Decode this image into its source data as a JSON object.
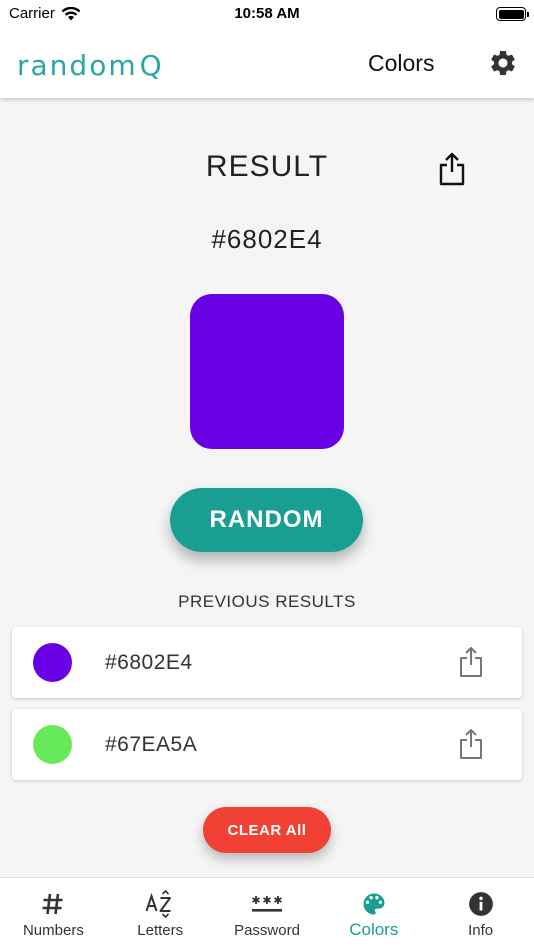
{
  "status_bar": {
    "carrier": "Carrier",
    "time": "10:58 AM"
  },
  "header": {
    "logo_text": "random",
    "logo_q": "Q",
    "title": "Colors"
  },
  "result": {
    "title": "RESULT",
    "hex": "#6802E4",
    "color": "#6802E4"
  },
  "random_button": {
    "label": "RANDOM"
  },
  "previous": {
    "title": "PREVIOUS RESULTS",
    "items": [
      {
        "hex": "#6802E4",
        "color": "#6802E4"
      },
      {
        "hex": "#67EA5A",
        "color": "#67EA5A"
      }
    ]
  },
  "clear_button": {
    "label": "CLEAR All"
  },
  "tabs": [
    {
      "label": "Numbers",
      "icon": "hash-icon"
    },
    {
      "label": "Letters",
      "icon": "az-sort-icon"
    },
    {
      "label": "Password",
      "icon": "password-asterisks-icon"
    },
    {
      "label": "Colors",
      "icon": "palette-icon",
      "active": true
    },
    {
      "label": "Info",
      "icon": "info-icon"
    }
  ],
  "colors": {
    "accent": "#199E92",
    "danger": "#F04134",
    "logo": "#2AA7A0"
  }
}
